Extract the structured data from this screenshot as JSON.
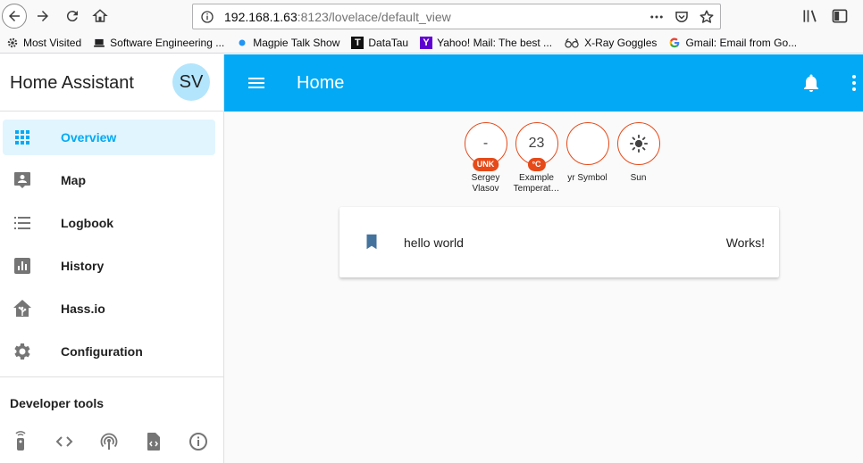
{
  "browser": {
    "url_host": "192.168.1.63",
    "url_rest": ":8123/lovelace/default_view",
    "bookmarks": [
      {
        "label": "Most Visited",
        "icon": "gear-icon"
      },
      {
        "label": "Software Engineering ...",
        "icon": "laptop-icon"
      },
      {
        "label": "Magpie Talk Show",
        "icon": "dot-icon"
      },
      {
        "label": "DataTau",
        "icon": "t-logo-icon"
      },
      {
        "label": "Yahoo! Mail: The best ...",
        "icon": "yahoo-icon"
      },
      {
        "label": "X-Ray Goggles",
        "icon": "goggles-icon"
      },
      {
        "label": "Gmail: Email from Go...",
        "icon": "google-icon"
      }
    ]
  },
  "sidebar": {
    "title": "Home Assistant",
    "avatar_initials": "SV",
    "items": [
      {
        "label": "Overview",
        "icon": "grid-icon",
        "active": true
      },
      {
        "label": "Map",
        "icon": "map-account-icon"
      },
      {
        "label": "Logbook",
        "icon": "list-icon"
      },
      {
        "label": "History",
        "icon": "chart-icon"
      },
      {
        "label": "Hass.io",
        "icon": "hassio-icon"
      },
      {
        "label": "Configuration",
        "icon": "gear-icon"
      }
    ],
    "developer_tools_title": "Developer tools"
  },
  "header": {
    "title": "Home"
  },
  "badges": [
    {
      "value": "-",
      "unit": "UNK",
      "name": "Sergey Vlasov"
    },
    {
      "value": "23",
      "unit": "°C",
      "name": "Example Temperat…"
    },
    {
      "value": "",
      "unit": "",
      "name": "yr Symbol"
    },
    {
      "value": "",
      "unit": "",
      "name": "Sun",
      "icon": "sun-icon"
    }
  ],
  "card": {
    "entity_name": "hello world",
    "state": "Works!",
    "icon": "bookmark-icon"
  },
  "colors": {
    "primary": "#03a9f4",
    "badge_accent": "#e64a19",
    "active_bg": "#e1f5fe",
    "icon_grey": "#44739e"
  }
}
